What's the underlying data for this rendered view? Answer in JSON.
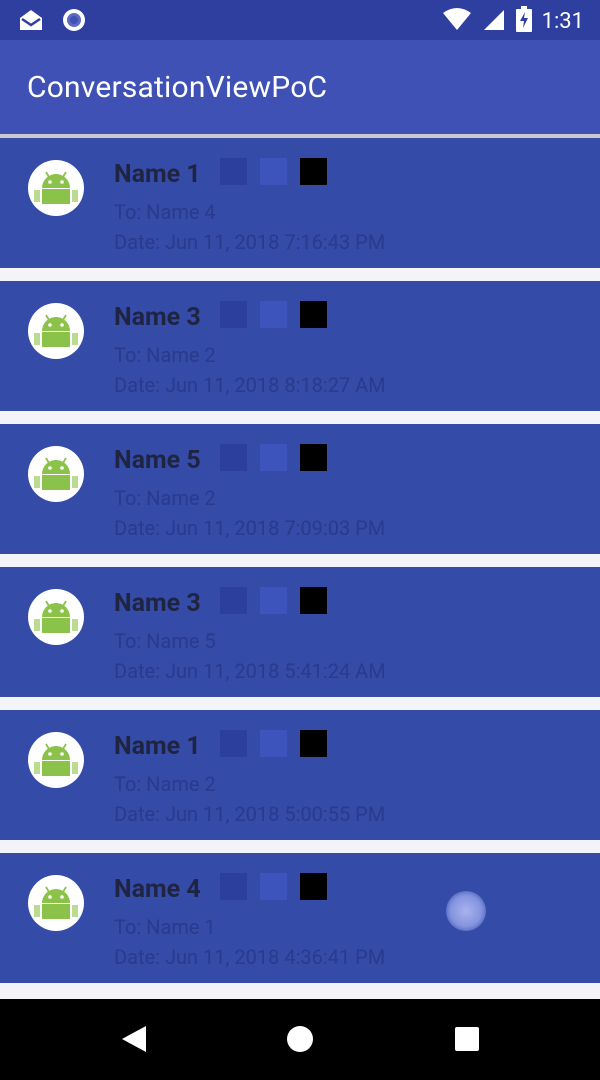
{
  "status_bar": {
    "time": "1:31",
    "icons": [
      "mail-notification-icon",
      "sync-circle-icon",
      "wifi-icon",
      "cell-signal-icon",
      "battery-charging-icon"
    ]
  },
  "app_bar": {
    "title": "ConversationViewPoC"
  },
  "conversations": [
    {
      "name": "Name 1",
      "to": "To:  Name 4",
      "date": "Date: Jun 11, 2018 7:16:43 PM"
    },
    {
      "name": "Name 3",
      "to": "To:  Name 2",
      "date": "Date: Jun 11, 2018 8:18:27 AM"
    },
    {
      "name": "Name 5",
      "to": "To:  Name 2",
      "date": "Date: Jun 11, 2018 7:09:03 PM"
    },
    {
      "name": "Name 3",
      "to": "To:  Name 5",
      "date": "Date: Jun 11, 2018 5:41:24 AM"
    },
    {
      "name": "Name 1",
      "to": "To:  Name 2",
      "date": "Date: Jun 11, 2018 5:00:55 PM"
    },
    {
      "name": "Name 4",
      "to": "To:  Name 1",
      "date": "Date: Jun 11, 2018 4:36:41 PM"
    }
  ],
  "colors": {
    "status_bar": "#2f3fa0",
    "app_bar": "#3f51b5",
    "card": "#344ba8",
    "square_1": "#2d3f9c",
    "square_2": "#3d54bd",
    "square_3": "#000000"
  },
  "nav_bar": {
    "icons": [
      "back-icon",
      "home-icon",
      "recents-icon"
    ]
  }
}
